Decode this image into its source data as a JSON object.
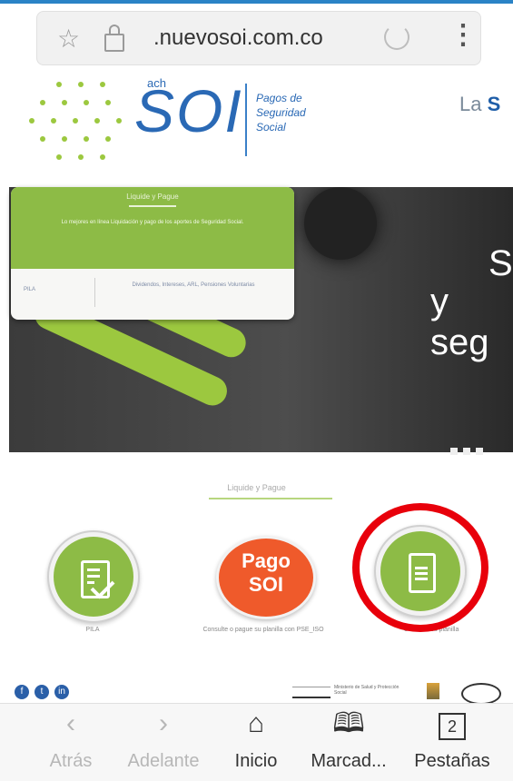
{
  "browser": {
    "url": ".nuevosoi.com.co",
    "bookmark_icon": "star-icon",
    "lock_icon": "lock-icon",
    "reload_icon": "reload-icon",
    "menu_icon": "more-vertical-icon"
  },
  "logo": {
    "ach": "ach",
    "name": "SOI",
    "tagline": "Pagos de Seguridad Social",
    "headline_prefix": "La ",
    "headline_bold": "S"
  },
  "hero": {
    "card": {
      "tab": "Liquide y Pague",
      "title": "Lo mejores en línea Liquidación y pago de los aportes de Seguridad Social.",
      "cell1": "PILA",
      "cell2": "Dividendos, Intereses, ARL, Pensiones Voluntarias"
    },
    "text_line1": "S",
    "text_line2": "y seg"
  },
  "services": {
    "tab_caption": "Liquide y Pague",
    "items": [
      {
        "caption": "PILA",
        "icon": "document-check-icon"
      },
      {
        "caption": "Consulte o pague su planilla con PSE_ISO",
        "logo_line1": "Pago",
        "logo_line2": "SOI"
      },
      {
        "caption": "Consulte su planilla",
        "icon": "document-icon"
      }
    ]
  },
  "footer": {
    "social": [
      "f",
      "t",
      "in"
    ],
    "partner_text": "Ministerio de Salud y Protección Social"
  },
  "bottom_nav": [
    {
      "label": "Atrás",
      "icon": "back-arrow-icon",
      "glyph": "‹"
    },
    {
      "label": "Adelante",
      "icon": "forward-arrow-icon",
      "glyph": "›"
    },
    {
      "label": "Inicio",
      "icon": "home-icon",
      "glyph": "⌂"
    },
    {
      "label": "Marcad...",
      "icon": "bookmarks-icon",
      "glyph": "🕮"
    },
    {
      "label": "Pestañas",
      "icon": "tabs-icon",
      "glyph": "2"
    }
  ],
  "colors": {
    "brand_blue": "#2a69b5",
    "brand_green": "#8dbb46",
    "pago_orange": "#ef5a2b",
    "highlight_red": "#e8000b"
  }
}
